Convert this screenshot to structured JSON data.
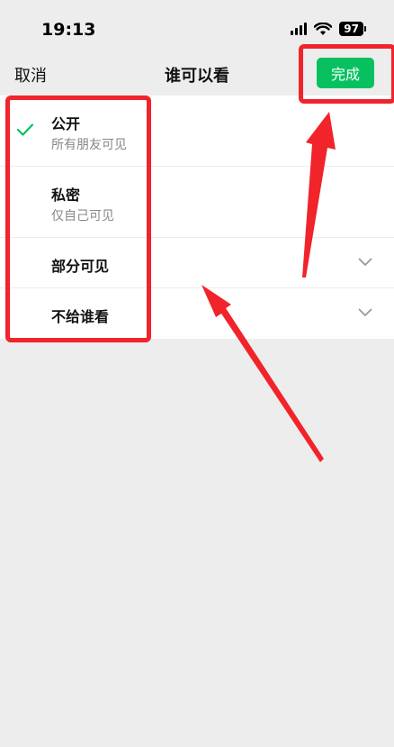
{
  "status_bar": {
    "time": "19:13",
    "battery": "97",
    "icons": [
      "signal-icon",
      "wifi-icon",
      "battery-icon"
    ]
  },
  "nav": {
    "cancel_label": "取消",
    "title": "谁可以看",
    "done_label": "完成"
  },
  "options": [
    {
      "label": "公开",
      "desc": "所有朋友可见",
      "selected": true
    },
    {
      "label": "私密",
      "desc": "仅自己可见",
      "selected": false
    },
    {
      "label": "部分可见",
      "desc": "",
      "selected": false,
      "expandable": true
    },
    {
      "label": "不给谁看",
      "desc": "",
      "selected": false,
      "expandable": true
    }
  ],
  "colors": {
    "accent": "#07c160",
    "annotation": "#f0242a",
    "background": "#ededed"
  }
}
